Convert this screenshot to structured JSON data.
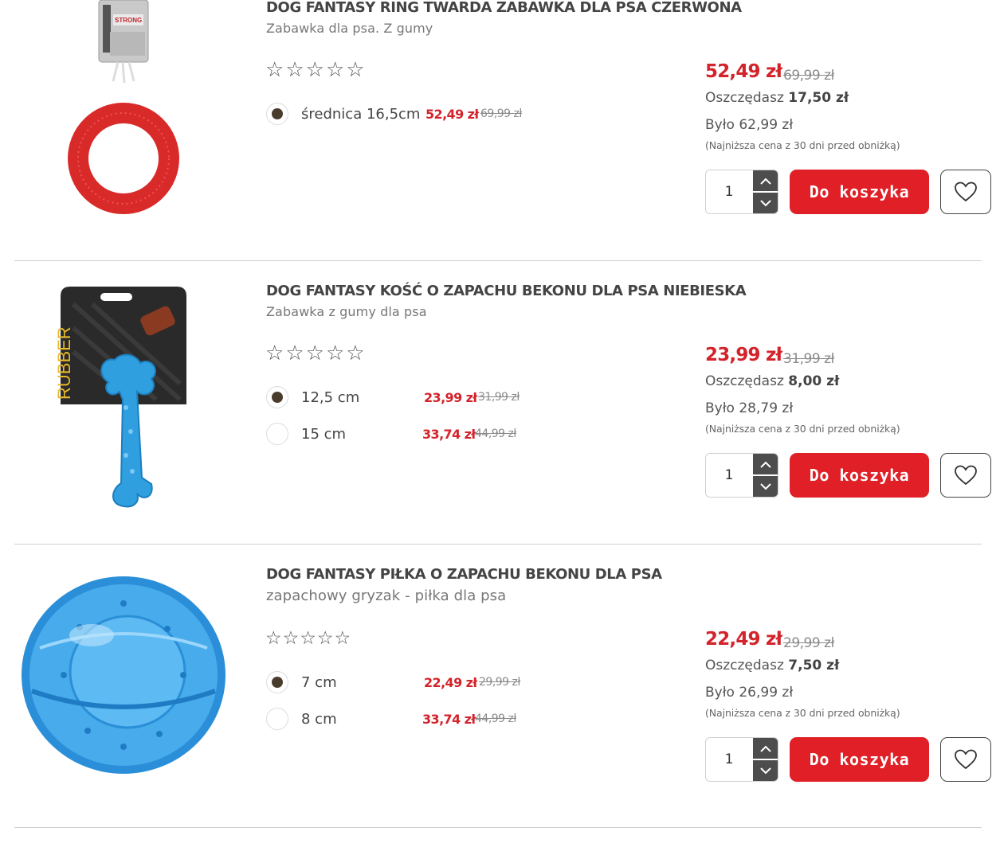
{
  "products": [
    {
      "title": "DOG FANTASY RING TWARDA ZABAWKA DLA PSA CZERWONA",
      "subtitle": "Zabawka  dla psa. Z gumy",
      "rating_stars": 0,
      "variants": [
        {
          "label": "średnica 16,5cm",
          "price": "52,49 zł",
          "old_price": "69,99 zł",
          "selected": true
        }
      ],
      "price": "52,49 zł",
      "old_price": "69,99 zł",
      "save_label": "Oszczędasz",
      "save_amount": "17,50 zł",
      "was": "Było 62,99 zł",
      "lowest_note": "(Najniższa cena z 30 dni przed obniżką)",
      "quantity": "1",
      "cart_label": "Do koszyka",
      "image_icon": "red-ring-toy-image"
    },
    {
      "title": "DOG FANTASY KOŚĆ O ZAPACHU BEKONU DLA PSA NIEBIESKA",
      "subtitle": "Zabawka z gumy dla psa",
      "rating_stars": 0,
      "variants": [
        {
          "label": "12,5 cm",
          "price": "23,99 zł",
          "old_price": "31,99 zł",
          "selected": true
        },
        {
          "label": "15 cm",
          "price": "33,74 zł",
          "old_price": "44,99 zł",
          "selected": false
        }
      ],
      "price": "23,99 zł",
      "old_price": "31,99 zł",
      "save_label": "Oszczędasz",
      "save_amount": "8,00 zł",
      "was": "Było 28,79 zł",
      "lowest_note": "(Najniższa cena z 30 dni przed obniżką)",
      "quantity": "1",
      "cart_label": "Do koszyka",
      "image_icon": "blue-bone-toy-image",
      "image_text": "RUBBER"
    },
    {
      "title": "DOG FANTASY PIŁKA O ZAPACHU BEKONU DLA PSA",
      "subtitle": "zapachowy gryzak - piłka dla psa",
      "rating_stars": 0,
      "variants": [
        {
          "label": "7 cm",
          "price": "22,49 zł",
          "old_price": "29,99 zł",
          "selected": true
        },
        {
          "label": "8 cm",
          "price": "33,74 zł",
          "old_price": "44,99 zł",
          "selected": false
        }
      ],
      "price": "22,49 zł",
      "old_price": "29,99 zł",
      "save_label": "Oszczędasz",
      "save_amount": "7,50 zł",
      "was": "Było 26,99 zł",
      "lowest_note": "(Najniższa cena z 30 dni przed obniżką)",
      "quantity": "1",
      "cart_label": "Do koszyka",
      "image_icon": "blue-ball-toy-image"
    }
  ],
  "colors": {
    "accent_red": "#e01f26",
    "price_red": "#d3232b",
    "selected_radio": "#4a3c2c",
    "toy_blue": "#2f9fe0"
  }
}
